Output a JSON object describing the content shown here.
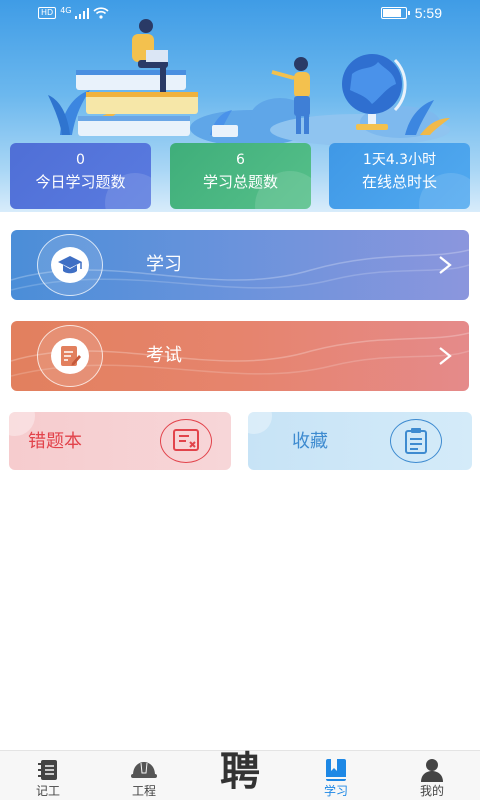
{
  "status_bar": {
    "hd": "HD",
    "network": "4G",
    "time": "5:59",
    "battery_level": 0.85
  },
  "stats": [
    {
      "value": "0",
      "label": "今日学习题数"
    },
    {
      "value": "6",
      "label": "学习总题数"
    },
    {
      "value": "1天4.3小时",
      "label": "在线总时长"
    }
  ],
  "menu": {
    "study": {
      "label": "学习",
      "icon": "graduation-cap-icon"
    },
    "exam": {
      "label": "考试",
      "icon": "exam-paper-icon"
    }
  },
  "shortcuts": {
    "wrong_book": {
      "label": "错题本",
      "icon": "wrong-answers-icon"
    },
    "favorites": {
      "label": "收藏",
      "icon": "clipboard-icon"
    }
  },
  "bottom_nav": [
    {
      "label": "记工",
      "icon": "notebook-icon",
      "active": false
    },
    {
      "label": "工程",
      "icon": "hard-hat-icon",
      "active": false
    },
    {
      "label": "聘",
      "icon": "recruit-logo",
      "active": false
    },
    {
      "label": "学习",
      "icon": "bookmark-book-icon",
      "active": true
    },
    {
      "label": "我的",
      "icon": "user-icon",
      "active": false
    }
  ],
  "colors": {
    "active_tab": "#1e88e5",
    "study_card": "#4b8ed8",
    "exam_card": "#e2805e",
    "wrong_book_text": "#e2434b",
    "favorites_text": "#3e8bd0"
  }
}
